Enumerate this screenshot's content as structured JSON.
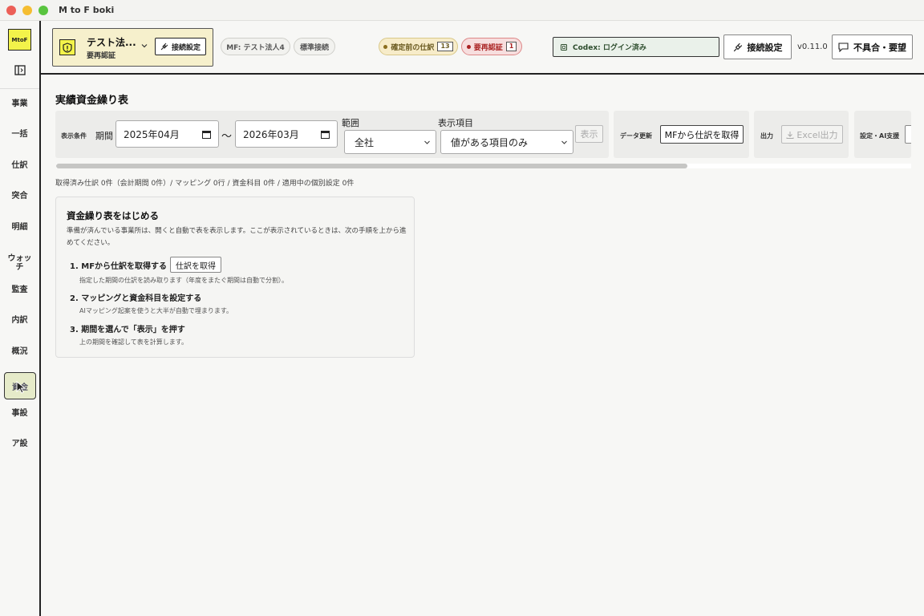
{
  "window": {
    "title": "M to F boki"
  },
  "rail": {
    "logo": "MtoF",
    "items": [
      "事業",
      "一括",
      "仕訳",
      "突合",
      "明細",
      "ウォッチ",
      "監査",
      "内訳",
      "概況",
      "資金",
      "事設",
      "ア設"
    ],
    "active_item": "資金"
  },
  "header": {
    "company_name": "テスト法...",
    "company_status": "要再認証",
    "connect_small_label": "接続設定",
    "mf_pill": "MF: テスト法人4",
    "std_pill": "標準接続",
    "pending_label": "確定前の仕訳",
    "pending_count": "13",
    "reauth_label": "要再認証",
    "reauth_count": "1",
    "codex_status": "Codex: ログイン済み",
    "connect_label": "接続設定",
    "version": "v0.11.0",
    "feedback_label": "不具合・要望",
    "colors": {
      "accent_yellow": "#f3f34a",
      "warn_bg": "#f7ecc9",
      "danger": "#a22",
      "codex_bg": "#eaf1ea"
    }
  },
  "main": {
    "title": "実績資金繰り表",
    "toolbar": {
      "conditions_label": "表示条件",
      "period_label": "期間",
      "start_date": "2025年04月",
      "tilde": "〜",
      "end_date": "2026年03月",
      "scope_label": "範囲",
      "scope_value": "全社",
      "items_label": "表示項目",
      "items_value": "値がある項目のみ",
      "show_button": "表示",
      "data_update_label": "データ更新",
      "fetch_button": "MFから仕訳を取得",
      "output_label": "出力",
      "excel_button": "Excel出力",
      "settings_label": "設定・AI支援"
    },
    "summary": "取得済み仕訳 0件（会計期間 0件）/ マッピング 0行 / 資金科目 0件 / 適用中の個別設定 0件",
    "card": {
      "title": "資金繰り表をはじめる",
      "description": "準備が済んでいる事業所は、開くと自動で表を表示します。ここが表示されているときは、次の手順を上から進めてください。",
      "steps": [
        {
          "label": "1. MFから仕訳を取得する",
          "sub": "指定した期間の仕訳を読み取ります（年度をまたぐ期間は自動で分割）。"
        },
        {
          "label": "2. マッピングと資金科目を設定する",
          "sub": "AIマッピング起案を使うと大半が自動で埋まります。"
        },
        {
          "label": "3. 期間を選んで「表示」を押す",
          "sub": "上の期間を確認して表を計算します。"
        }
      ],
      "step1_button": "仕訳を取得"
    }
  }
}
